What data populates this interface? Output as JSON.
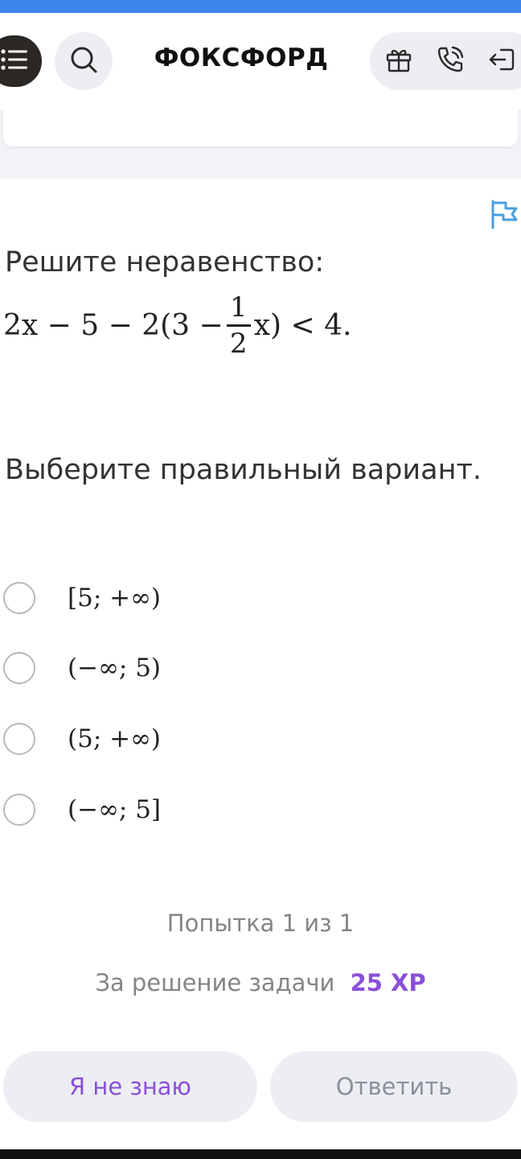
{
  "header": {
    "logo": "ФОКСФОРД",
    "icons": [
      "menu-icon",
      "search-icon",
      "gift-icon",
      "phone-icon",
      "logout-icon"
    ]
  },
  "task": {
    "title": "Решите неравенство:",
    "formula": {
      "before_frac": "2x − 5 − 2(3 − ",
      "frac_num": "1",
      "frac_den": "2",
      "after_frac": "x) < 4."
    },
    "prompt": "Выберите правильный вариант.",
    "options": [
      {
        "label": "[5; +∞)",
        "selected": false
      },
      {
        "label": "(−∞; 5)",
        "selected": false
      },
      {
        "label": "(5; +∞)",
        "selected": false
      },
      {
        "label": "(−∞; 5]",
        "selected": false
      }
    ]
  },
  "footer": {
    "attempt": "Попытка 1 из 1",
    "reward_label": "За решение задачи",
    "reward_xp": "25 XP",
    "dont_know_label": "Я не знаю",
    "answer_label": "Ответить"
  },
  "colors": {
    "accent_purple": "#8a4fd8",
    "top_strip_blue": "#3d86ec",
    "flag_blue": "#4a9fe0"
  }
}
